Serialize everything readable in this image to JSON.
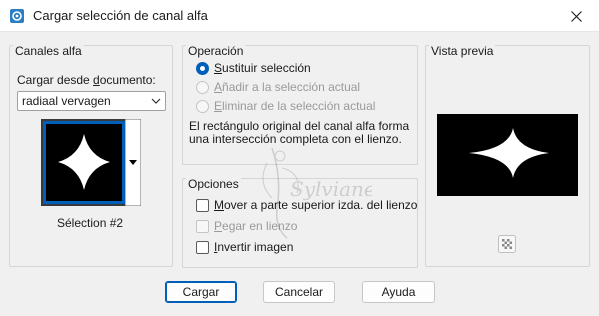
{
  "window": {
    "title": "Cargar selección de canal alfa",
    "accent": "#005fb8"
  },
  "canales": {
    "legend": "Canales alfa",
    "load_label_pre": "Cargar desde ",
    "load_label_ul": "d",
    "load_label_post": "ocumento:",
    "document": "radiaal vervagen",
    "channel_name": "Sélection #2"
  },
  "operacion": {
    "legend": "Operación",
    "options": [
      {
        "ul": "S",
        "rest": "ustituir selección",
        "checked": true,
        "enabled": true
      },
      {
        "ul": "A",
        "rest": "ñadir a la selección actual",
        "checked": false,
        "enabled": false
      },
      {
        "ul": "E",
        "rest": "liminar de la selección actual",
        "checked": false,
        "enabled": false
      }
    ],
    "description": "El rectángulo original del canal alfa forma una intersección completa con el lienzo."
  },
  "opciones": {
    "legend": "Opciones",
    "items": [
      {
        "ul": "M",
        "rest": "over a parte superior izda. del lienzo",
        "checked": false,
        "enabled": true
      },
      {
        "ul": "P",
        "rest": "egar en lienzo",
        "checked": false,
        "enabled": false
      },
      {
        "ul": "I",
        "rest": "nvertir imagen",
        "checked": false,
        "enabled": true
      }
    ]
  },
  "preview": {
    "legend": "Vista previa"
  },
  "buttons": {
    "ok": "Cargar",
    "cancel": "Cancelar",
    "help": "Ayuda"
  },
  "watermark_text": "Sylviane",
  "icons": [
    "app-icon",
    "close-icon",
    "chevron-down-icon",
    "dropdown-arrow-icon",
    "transparency-icon"
  ]
}
